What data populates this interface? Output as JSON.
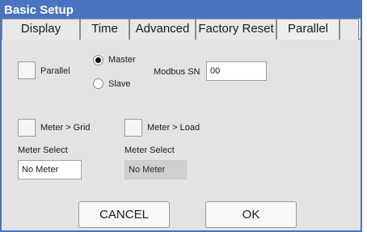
{
  "title": "Basic Setup",
  "tabs": [
    {
      "label": "Display"
    },
    {
      "label": "Time"
    },
    {
      "label": "Advanced"
    },
    {
      "label": "Factory Reset"
    },
    {
      "label": "Parallel"
    }
  ],
  "parallel": {
    "label": "Parallel",
    "mode_options": [
      "Master",
      "Slave"
    ],
    "selected_mode": "Master",
    "modbus_label": "Modbus SN",
    "modbus_value": "00"
  },
  "meters": {
    "grid_label": "Meter > Grid",
    "load_label": "Meter > Load",
    "grid_select_label": "Meter Select",
    "grid_select_value": "No Meter",
    "load_select_label": "Meter Select",
    "load_select_value": "No Meter"
  },
  "buttons": {
    "cancel": "CANCEL",
    "ok": "OK"
  }
}
